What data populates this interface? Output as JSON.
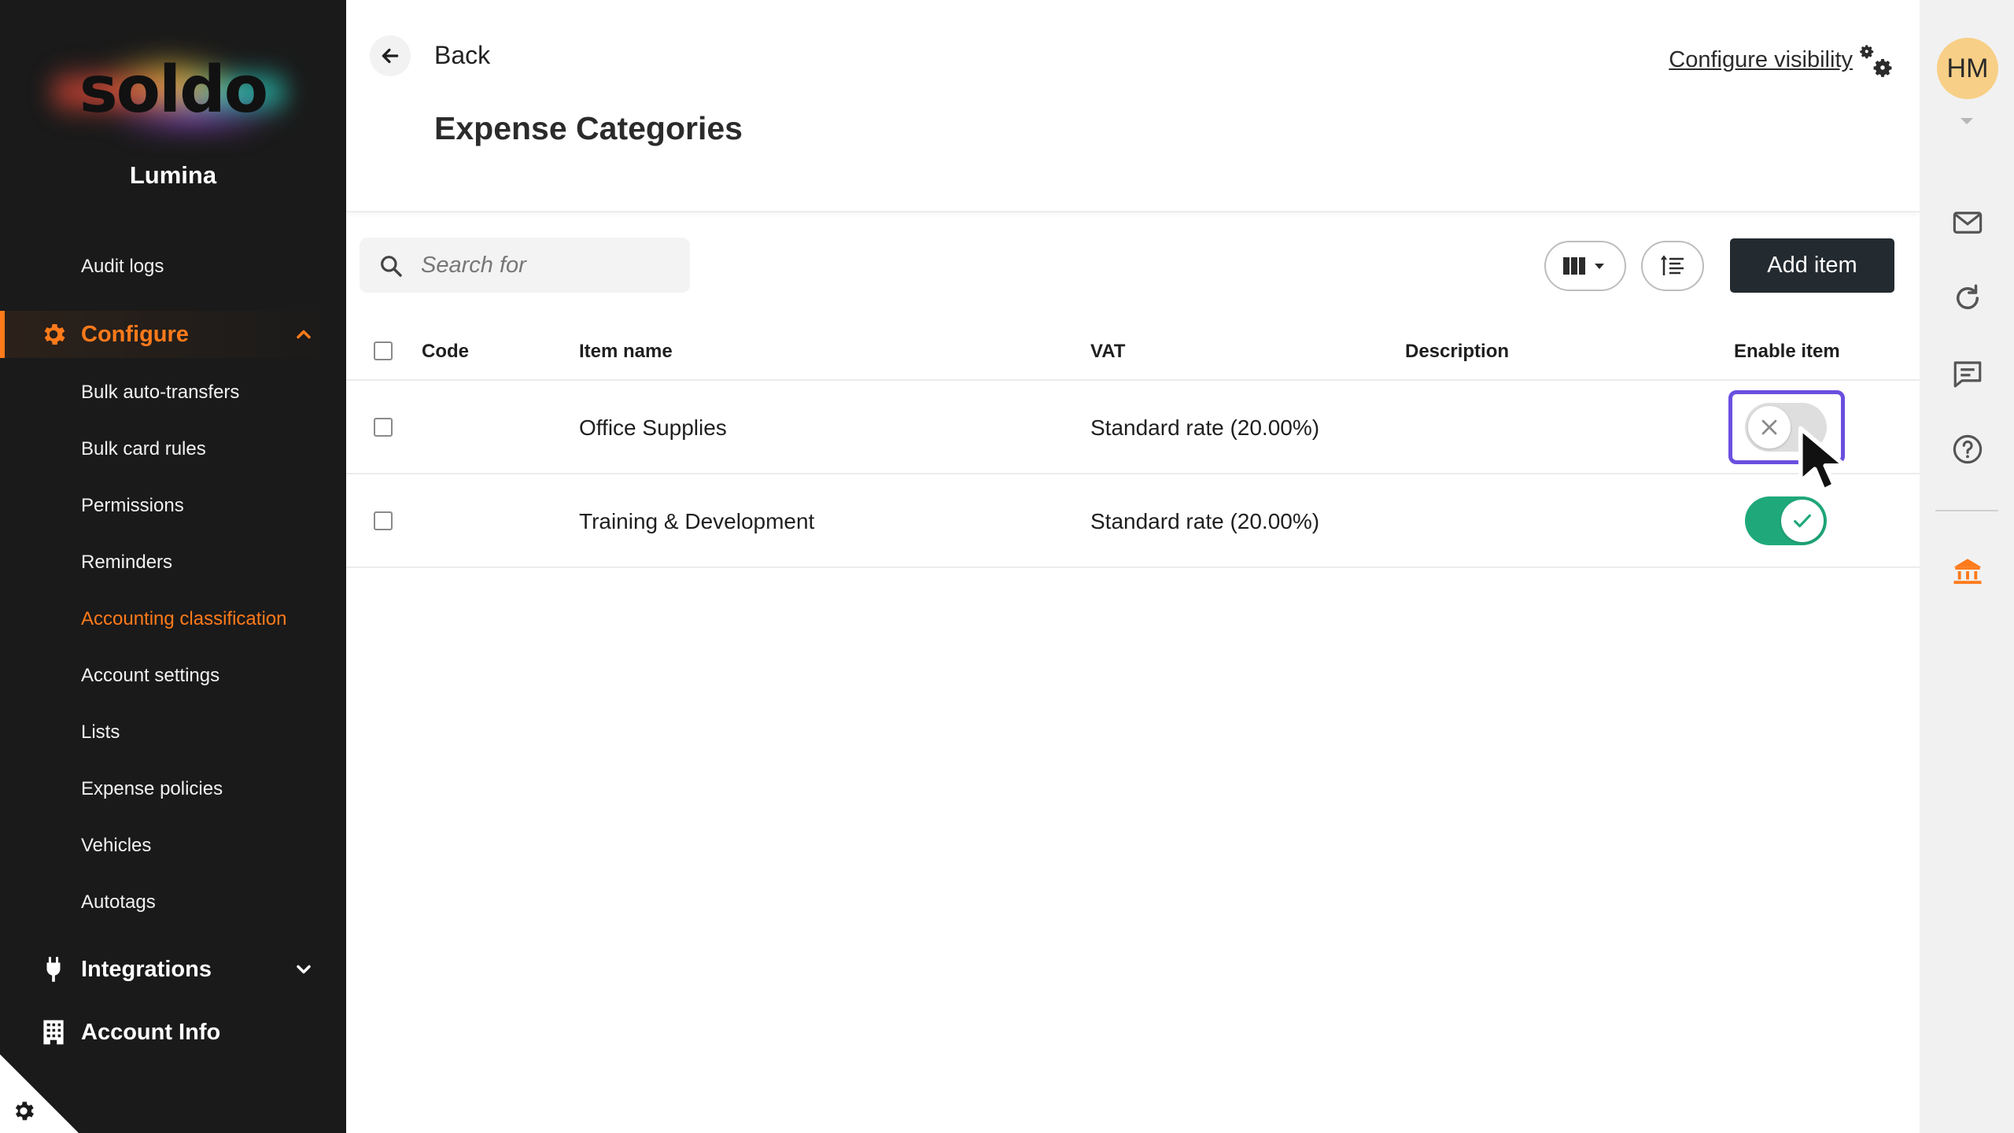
{
  "brand": {
    "logo_text": "soldo",
    "org_name": "Lumina"
  },
  "sidebar": {
    "top_items": [
      {
        "label": "Audit logs"
      }
    ],
    "configure": {
      "label": "Configure",
      "expanded": true,
      "items": [
        {
          "label": "Bulk auto-transfers"
        },
        {
          "label": "Bulk card rules"
        },
        {
          "label": "Permissions"
        },
        {
          "label": "Reminders"
        },
        {
          "label": "Accounting classification",
          "active": true
        },
        {
          "label": "Account settings"
        },
        {
          "label": "Lists"
        },
        {
          "label": "Expense policies"
        },
        {
          "label": "Vehicles"
        },
        {
          "label": "Autotags"
        }
      ]
    },
    "integrations": {
      "label": "Integrations"
    },
    "account_info": {
      "label": "Account Info"
    },
    "accent_color": "#ff7a1a"
  },
  "header": {
    "back_label": "Back",
    "title": "Expense Categories",
    "configure_visibility": "Configure visibility"
  },
  "toolbar": {
    "search_placeholder": "Search for",
    "search_value": "",
    "add_label": "Add item"
  },
  "table": {
    "columns": {
      "code": "Code",
      "item_name": "Item name",
      "vat": "VAT",
      "description": "Description",
      "enable": "Enable item"
    },
    "rows": [
      {
        "code": "",
        "item_name": "Office Supplies",
        "vat": "Standard rate (20.00%)",
        "description": "",
        "enabled": false
      },
      {
        "code": "",
        "item_name": "Training & Development",
        "vat": "Standard rate (20.00%)",
        "description": "",
        "enabled": true
      }
    ]
  },
  "user": {
    "initials": "HM"
  },
  "rail_icons": [
    "mail-icon",
    "refresh-icon",
    "chat-icon",
    "help-icon",
    "bank-icon"
  ],
  "colors": {
    "toggle_on": "#1fa97a",
    "focus_ring": "#6a4fe0",
    "primary_button": "#232a30"
  }
}
